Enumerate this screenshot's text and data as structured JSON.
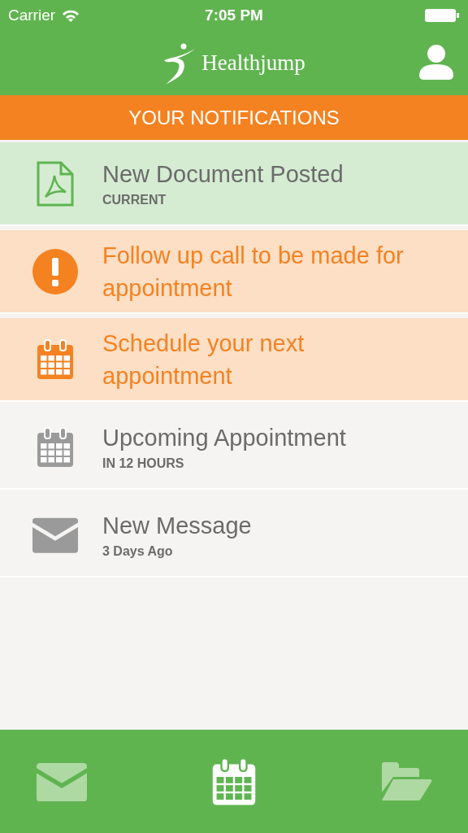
{
  "status_bar": {
    "carrier": "Carrier",
    "time": "7:05 PM"
  },
  "header": {
    "logo_text": "Healthjump"
  },
  "banner": {
    "title": "YOUR NOTIFICATIONS"
  },
  "notifications": [
    {
      "kind": "document",
      "color": "#5fb551",
      "highlighted": true,
      "urgent": false,
      "title": "New Document Posted",
      "subtitle": "CURRENT"
    },
    {
      "kind": "alert",
      "color": "#f48221",
      "highlighted": true,
      "urgent": true,
      "title": "Follow up call to be made for appointment"
    },
    {
      "kind": "calendar",
      "color": "#f48221",
      "highlighted": true,
      "urgent": true,
      "title": "Schedule your next appointment"
    },
    {
      "kind": "calendar",
      "color": "#9a9a9a",
      "highlighted": false,
      "urgent": false,
      "title": "Upcoming Appointment",
      "subtitle": "IN 12 HOURS"
    },
    {
      "kind": "mail",
      "color": "#9a9a9a",
      "highlighted": false,
      "urgent": false,
      "title": "New Message",
      "subtitle": "3 Days Ago"
    }
  ],
  "tab_bar": [
    {
      "kind": "mail",
      "selected": false
    },
    {
      "kind": "calendar",
      "selected": true
    },
    {
      "kind": "folder",
      "selected": false
    }
  ]
}
